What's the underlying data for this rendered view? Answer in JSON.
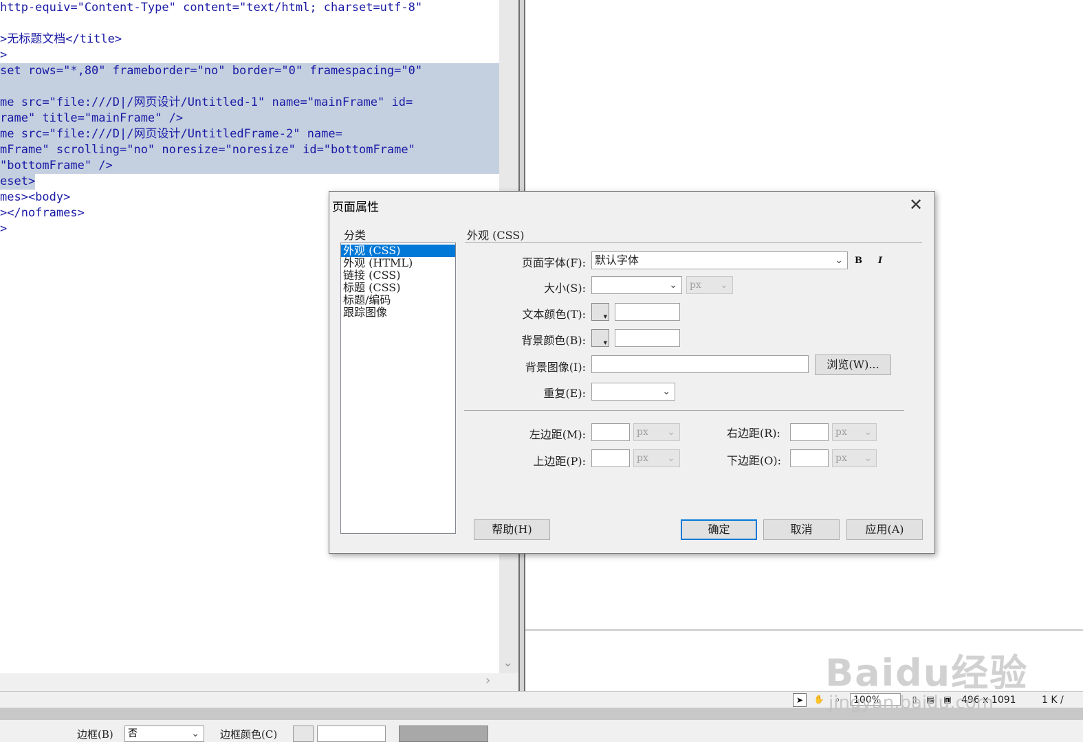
{
  "code": {
    "lines": [
      {
        "text": "http-equiv=\"Content-Type\" content=\"text/html; charset=utf-8\"",
        "highlighted": false
      },
      {
        "text": "",
        "highlighted": false
      },
      {
        "text": ">无标题文档</title>",
        "highlighted": false
      },
      {
        "text": ">",
        "highlighted": false
      },
      {
        "text": "set rows=\"*,80\" frameborder=\"no\" border=\"0\" framespacing=\"0\"",
        "highlighted": true
      },
      {
        "text": "",
        "highlighted": true
      },
      {
        "text": "me src=\"file:///D|/网页设计/Untitled-1\" name=\"mainFrame\" id=",
        "highlighted": true
      },
      {
        "text": "rame\" title=\"mainFrame\" />",
        "highlighted": true
      },
      {
        "text": "me src=\"file:///D|/网页设计/UntitledFrame-2\" name=",
        "highlighted": true
      },
      {
        "text": "mFrame\" scrolling=\"no\" noresize=\"noresize\" id=\"bottomFrame\"",
        "highlighted": true
      },
      {
        "text": "\"bottomFrame\" />",
        "highlighted": true
      },
      {
        "text": "eset>",
        "highlighted": "partial"
      },
      {
        "text": "mes><body>",
        "highlighted": false
      },
      {
        "text": "></noframes>",
        "highlighted": false
      },
      {
        "text": ">",
        "highlighted": false
      }
    ]
  },
  "status_bar": {
    "zoom": "100%",
    "dimensions": "496 x 1091",
    "size": "1 K /"
  },
  "properties_panel": {
    "border_label": "边框(B)",
    "border_value": "否",
    "border_color_label": "边框颜色(C)"
  },
  "dialog": {
    "title": "页面属性",
    "close_glyph": "✕",
    "category_header": "分类",
    "categories": [
      "外观 (CSS)",
      "外观 (HTML)",
      "链接 (CSS)",
      "标题 (CSS)",
      "标题/编码",
      "跟踪图像"
    ],
    "selected_category": 0,
    "section_title": "外观 (CSS)",
    "fields": {
      "page_font_label": "页面字体(F):",
      "page_font_value": "默认字体",
      "bold_label": "B",
      "italic_label": "I",
      "size_label": "大小(S):",
      "size_value": "",
      "size_unit": "px",
      "text_color_label": "文本颜色(T):",
      "text_color_value": "",
      "bg_color_label": "背景颜色(B):",
      "bg_color_value": "",
      "bg_image_label": "背景图像(I):",
      "bg_image_value": "",
      "browse_label": "浏览(W)...",
      "repeat_label": "重复(E):",
      "repeat_value": "",
      "left_margin_label": "左边距(M):",
      "right_margin_label": "右边距(R):",
      "top_margin_label": "上边距(P):",
      "bottom_margin_label": "下边距(O):",
      "margin_unit": "px"
    },
    "buttons": {
      "help": "帮助(H)",
      "ok": "确定",
      "cancel": "取消",
      "apply": "应用(A)"
    }
  },
  "watermark": {
    "brand": "Baidu经验",
    "url": "jingyan.baidu.com"
  },
  "colors": {
    "code_text": "#1a1aa6",
    "selection_bg": "#c4d0df",
    "list_selection": "#0078d7"
  }
}
